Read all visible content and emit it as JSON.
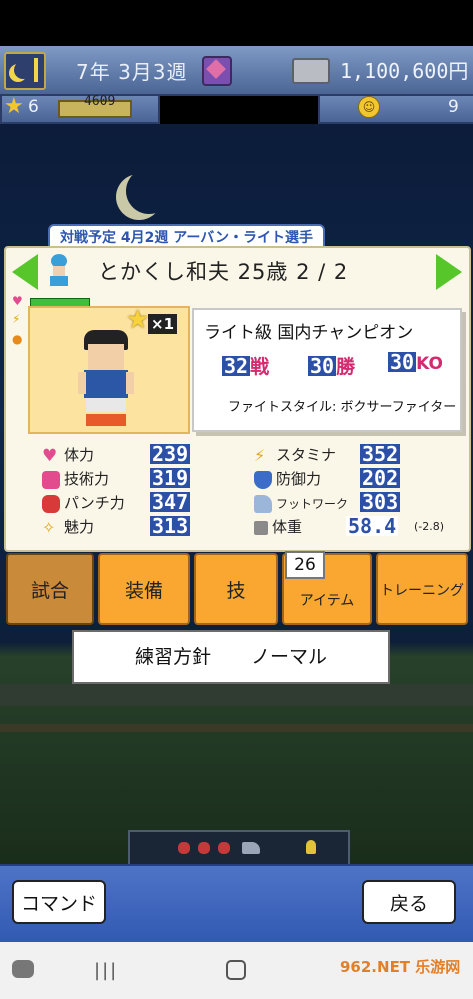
{
  "hud": {
    "date": "7年 3月3週",
    "money": "1,100,600円",
    "stars": "6",
    "exp": "4609",
    "smiles": "9"
  },
  "schedule_tag": "対戦予定 4月2週 アーバン・ライト選手",
  "character": {
    "name_line": "とかくし和夫 25歳 2 / 2",
    "badge": "×1"
  },
  "record": {
    "title": "ライト級 国内チャンピオン",
    "fights_num": "32",
    "fights_label": "戦",
    "wins_num": "30",
    "wins_label": "勝",
    "ko_num": "30",
    "ko_label": "KO",
    "style": "ファイトスタイル: ボクサーファイター"
  },
  "stats_left": [
    {
      "label": "体力",
      "value": "239"
    },
    {
      "label": "技術力",
      "value": "319"
    },
    {
      "label": "パンチ力",
      "value": "347"
    },
    {
      "label": "魅力",
      "value": "313"
    }
  ],
  "stats_right": [
    {
      "label": "スタミナ",
      "value": "352"
    },
    {
      "label": "防御力",
      "value": "202"
    },
    {
      "label": "フットワーク",
      "value": "303"
    },
    {
      "label": "体重",
      "value": "58.4",
      "delta": "(-2.8)"
    }
  ],
  "commands": [
    "試合",
    "装備",
    "技",
    "アイテム",
    "トレーニング"
  ],
  "item_count": "26",
  "policy": {
    "label": "練習方針",
    "value": "ノーマル"
  },
  "footer": {
    "command": "コマンド",
    "back": "戻る"
  },
  "watermark": "962.NET 乐游网",
  "colors": {
    "accent_orange": "#f9a731",
    "stat_blue": "#2c4fa8",
    "hp_green": "#3fbf3f"
  }
}
